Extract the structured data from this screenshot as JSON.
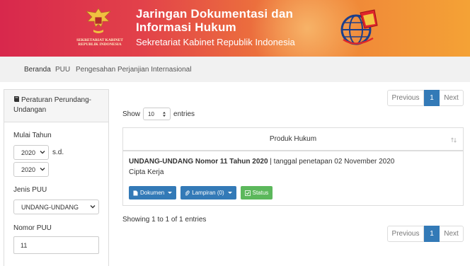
{
  "banner": {
    "emblem_text_1": "SEKRETARIAT KABINET",
    "emblem_text_2": "REPUBLIK INDONESIA",
    "title_line1": "Jaringan Dokumentasi dan",
    "title_line2": "Informasi Hukum",
    "subtitle": "Sekretariat Kabinet Republik Indonesia"
  },
  "nav": {
    "items": [
      "Beranda",
      "PUU",
      "Pengesahan Perjanjian Internasional"
    ]
  },
  "sidebar": {
    "heading": "Peraturan Perundang-Undangan",
    "year_label": "Mulai Tahun",
    "year_from": "2020",
    "sd_label": "s.d.",
    "year_to": "2020",
    "jenis_label": "Jenis PUU",
    "jenis_value": "UNDANG-UNDANG",
    "nomor_label": "Nomor PUU",
    "nomor_value": "11"
  },
  "table_controls": {
    "show_label": "Show",
    "entries_value": "10",
    "entries_label": "entries",
    "info": "Showing 1 to 1 of 1 entries"
  },
  "pagination": {
    "previous": "Previous",
    "current": "1",
    "next": "Next"
  },
  "table": {
    "header": "Produk Hukum",
    "rows": [
      {
        "title_bold": "UNDANG-UNDANG Nomor 11 Tahun 2020",
        "title_rest": " | tanggal penetapan 02 November 2020",
        "subject": "Cipta Kerja",
        "buttons": {
          "dokumen": "Dokumen",
          "lampiran": "Lampiran (0)",
          "status": "Status"
        }
      }
    ]
  },
  "colors": {
    "banner_start": "#d8284c",
    "banner_end": "#f4a236",
    "primary": "#337ab7",
    "success": "#5cb85c"
  }
}
